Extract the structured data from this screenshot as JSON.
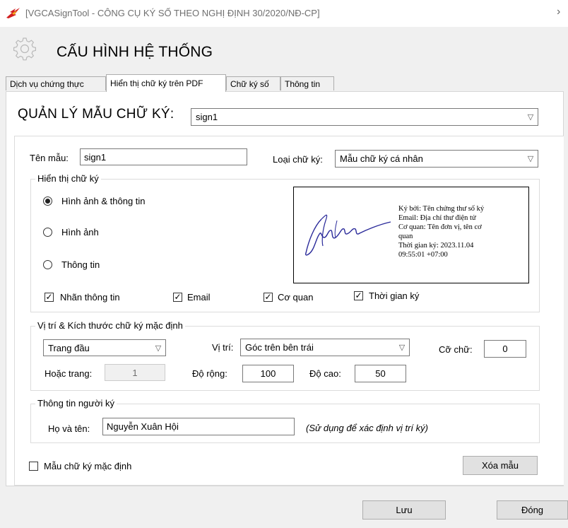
{
  "window": {
    "title": "[VGCASignTool - CÔNG CỤ KÝ SỐ THEO NGHỊ ĐỊNH 30/2020/NĐ-CP]"
  },
  "header": {
    "title": "CẤU HÌNH HỆ THỐNG",
    "icon": "gear-icon"
  },
  "tabs": [
    {
      "label": "Dịch vụ chứng thực",
      "active": false
    },
    {
      "label": "Hiển thị chữ ký trên PDF",
      "active": true
    },
    {
      "label": "Chữ ký số",
      "active": false
    },
    {
      "label": "Thông tin",
      "active": false
    }
  ],
  "manager": {
    "label": "QUẢN LÝ MẪU CHỮ KÝ:",
    "selected": "sign1"
  },
  "template": {
    "name_label": "Tên mẫu:",
    "name_value": "sign1",
    "type_label": "Loại chữ ký:",
    "type_value": "Mẫu chữ ký cá nhân"
  },
  "display": {
    "legend": "Hiển thị chữ ký",
    "options": [
      {
        "label": "Hình ảnh & thông tin",
        "selected": true
      },
      {
        "label": "Hình ảnh",
        "selected": false
      },
      {
        "label": "Thông tin",
        "selected": false
      }
    ],
    "checks": [
      {
        "label": "Nhãn thông tin",
        "checked": true
      },
      {
        "label": "Email",
        "checked": true
      },
      {
        "label": "Cơ quan",
        "checked": true
      },
      {
        "label": "Thời gian ký",
        "checked": true
      }
    ],
    "preview": {
      "line1": "Ký bởi: Tên chứng thư số ký",
      "line2": "Email: Địa chỉ thư điện tử",
      "line3": "Cơ quan: Tên đơn vị, tên cơ",
      "line4": "quan",
      "line5": "Thời gian ký: 2023.11.04",
      "line6": "09:55:01 +07:00"
    }
  },
  "position": {
    "legend": "Vị trí  & Kích thước chữ ký mặc định",
    "page_value": "Trang đầu",
    "or_page_label": "Hoặc trang:",
    "or_page_value": "1",
    "pos_label": "Vị trí:",
    "pos_value": "Góc trên bên trái",
    "fontsize_label": "Cỡ chữ:",
    "fontsize_value": "0",
    "width_label": "Độ rộng:",
    "width_value": "100",
    "height_label": "Độ cao:",
    "height_value": "50"
  },
  "signer": {
    "legend": "Thông tin người ký",
    "name_label": "Họ và tên:",
    "name_value": "Nguyễn Xuân Hội",
    "hint": "(Sử dụng để xác định vị trí ký)"
  },
  "default_template": {
    "label": "Mẫu chữ ký mặc định",
    "checked": false
  },
  "buttons": {
    "delete": "Xóa mẫu",
    "save": "Lưu",
    "close": "Đóng"
  }
}
